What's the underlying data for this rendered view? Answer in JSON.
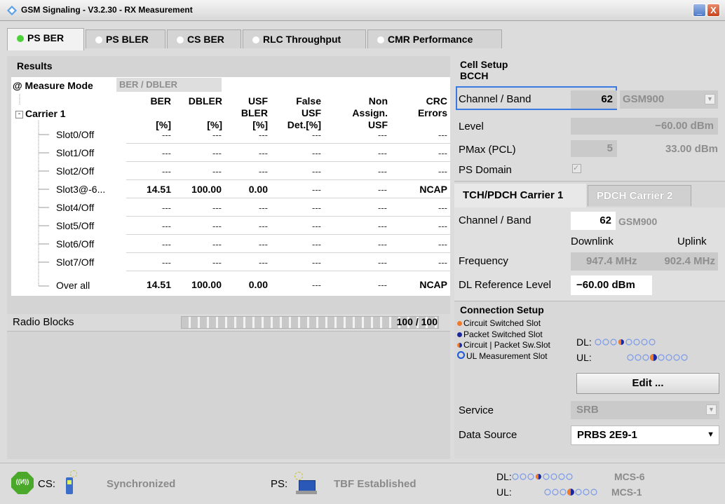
{
  "window": {
    "title": "GSM Signaling  - V3.2.30 - RX Measurement",
    "minimize_glyph": "_",
    "close_glyph": "X"
  },
  "tabs": [
    {
      "label": "PS BER",
      "active": true
    },
    {
      "label": "PS BLER",
      "active": false
    },
    {
      "label": "CS BER",
      "active": false
    },
    {
      "label": "RLC Throughput",
      "active": false
    },
    {
      "label": "CMR Performance",
      "active": false
    }
  ],
  "results": {
    "title": "Results",
    "measure_mode_label": "@ Measure Mode",
    "measure_mode_value": "BER / DBLER",
    "carrier_label": "Carrier 1",
    "tree_toggle": "-",
    "columns": [
      {
        "line1": "BER",
        "line2": "",
        "line3": "[%]"
      },
      {
        "line1": "DBLER",
        "line2": "",
        "line3": "[%]"
      },
      {
        "line1": "USF",
        "line2": "BLER",
        "line3": "[%]"
      },
      {
        "line1": "False",
        "line2": "USF",
        "line3": "Det.[%]"
      },
      {
        "line1": "Non",
        "line2": "Assign.",
        "line3": "USF"
      },
      {
        "line1": "CRC",
        "line2": "Errors",
        "line3": ""
      }
    ],
    "rows": [
      {
        "label": "Slot0/Off",
        "values": [
          "---",
          "---",
          "---",
          "---",
          "---",
          "---"
        ],
        "bold": false
      },
      {
        "label": "Slot1/Off",
        "values": [
          "---",
          "---",
          "---",
          "---",
          "---",
          "---"
        ],
        "bold": false
      },
      {
        "label": "Slot2/Off",
        "values": [
          "---",
          "---",
          "---",
          "---",
          "---",
          "---"
        ],
        "bold": false
      },
      {
        "label": "Slot3@-6...",
        "values": [
          "14.51",
          "100.00",
          "0.00",
          "---",
          "---",
          "NCAP"
        ],
        "bold": true
      },
      {
        "label": "Slot4/Off",
        "values": [
          "---",
          "---",
          "---",
          "---",
          "---",
          "---"
        ],
        "bold": false
      },
      {
        "label": "Slot5/Off",
        "values": [
          "---",
          "---",
          "---",
          "---",
          "---",
          "---"
        ],
        "bold": false
      },
      {
        "label": "Slot6/Off",
        "values": [
          "---",
          "---",
          "---",
          "---",
          "---",
          "---"
        ],
        "bold": false
      },
      {
        "label": "Slot7/Off",
        "values": [
          "---",
          "---",
          "---",
          "---",
          "---",
          "---"
        ],
        "bold": false
      },
      {
        "label": "Over all",
        "values": [
          "14.51",
          "100.00",
          "0.00",
          "---",
          "---",
          "NCAP"
        ],
        "bold": true
      }
    ],
    "radio_blocks_label": "Radio Blocks",
    "radio_blocks_value": "100 / 100",
    "radio_blocks_progress": 1.0
  },
  "cell_setup": {
    "title": "Cell Setup",
    "subtitle": "BCCH",
    "channel_band_label": "Channel / Band",
    "channel_value": "62",
    "band_value": "GSM900",
    "level_label": "Level",
    "level_value": "−60.00  dBm",
    "pmax_label": "PMax (PCL)",
    "pmax_pcl": "5",
    "pmax_value": "33.00  dBm",
    "ps_domain_label": "PS Domain",
    "ps_domain_checked": true,
    "check_glyph": "✓"
  },
  "carrier_tabs": [
    {
      "label": "TCH/PDCH Carrier 1",
      "active": true
    },
    {
      "label": "PDCH Carrier 2",
      "active": false
    }
  ],
  "tch_pdch": {
    "channel_band_label": "Channel / Band",
    "channel_value": "62",
    "band_value": "GSM900",
    "downlink_label": "Downlink",
    "uplink_label": "Uplink",
    "frequency_label": "Frequency",
    "dl_freq": "947.4  MHz",
    "ul_freq": "902.4  MHz",
    "dl_ref_label": "DL Reference Level",
    "dl_ref_value": "−60.00  dBm"
  },
  "connection_setup": {
    "title": "Connection Setup",
    "legend": [
      {
        "label": "Circuit Switched Slot",
        "color": "#f07a2a"
      },
      {
        "label": "Packet Switched Slot",
        "color": "#1a2a9e"
      },
      {
        "label": "Circuit | Packet Sw.Slot",
        "color": "#f07a2a"
      },
      {
        "label": "UL Measurement Slot",
        "color": "#1a5adb"
      }
    ],
    "dl_label": "DL:",
    "ul_label": "UL:",
    "edit_label": "Edit ...",
    "service_label": "Service",
    "service_value": "SRB",
    "data_source_label": "Data Source",
    "data_source_value": "PRBS 2E9-1",
    "dropdown_glyph": "▼"
  },
  "status": {
    "cs_label": "CS:",
    "cs_state": "Synchronized",
    "ps_label": "PS:",
    "ps_state": "TBF Established",
    "dl_label": "DL:",
    "ul_label": "UL:",
    "dl_mcs": "MCS-6",
    "ul_mcs": "MCS-1",
    "badge_glyph": "((И))"
  },
  "colors": {
    "active_tab_dot": "#4cd13a",
    "cs_slot": "#f07a2a",
    "ps_slot": "#1a2a9e",
    "ul_meas": "#1a5adb"
  }
}
